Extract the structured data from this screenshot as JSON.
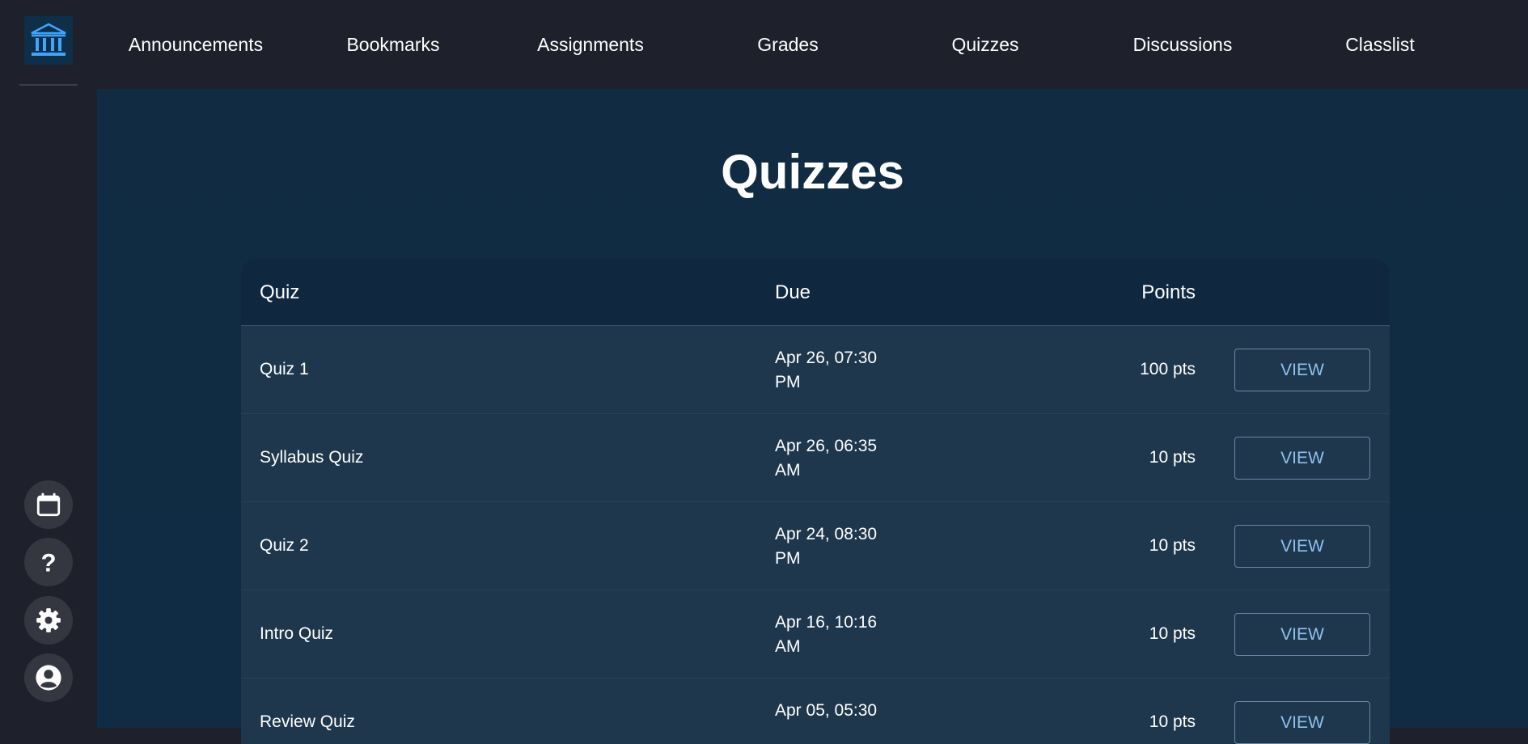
{
  "nav": {
    "items": [
      {
        "label": "Announcements"
      },
      {
        "label": "Bookmarks"
      },
      {
        "label": "Assignments"
      },
      {
        "label": "Grades"
      },
      {
        "label": "Quizzes"
      },
      {
        "label": "Discussions"
      },
      {
        "label": "Classlist"
      }
    ]
  },
  "sidebar": {
    "logo_icon": "institution-icon",
    "buttons": [
      {
        "icon": "calendar-icon"
      },
      {
        "icon": "help-icon"
      },
      {
        "icon": "settings-icon"
      },
      {
        "icon": "account-icon"
      }
    ]
  },
  "page": {
    "title": "Quizzes"
  },
  "table": {
    "headers": {
      "quiz": "Quiz",
      "due": "Due",
      "points": "Points"
    },
    "rows": [
      {
        "name": "Quiz 1",
        "due_line1": "Apr 26, 07:30",
        "due_line2": "PM",
        "points": "100 pts",
        "action": "VIEW"
      },
      {
        "name": "Syllabus Quiz",
        "due_line1": "Apr 26, 06:35",
        "due_line2": "AM",
        "points": "10 pts",
        "action": "VIEW"
      },
      {
        "name": "Quiz 2",
        "due_line1": "Apr 24, 08:30",
        "due_line2": "PM",
        "points": "10 pts",
        "action": "VIEW"
      },
      {
        "name": "Intro Quiz",
        "due_line1": "Apr 16, 10:16",
        "due_line2": "AM",
        "points": "10 pts",
        "action": "VIEW"
      },
      {
        "name": "Review Quiz",
        "due_line1": "Apr 05, 05:30",
        "due_line2": "",
        "points": "10 pts",
        "action": "VIEW"
      }
    ]
  },
  "colors": {
    "background": "#1e212b",
    "main_bg": "#112c42",
    "table_row": "#1f374d",
    "table_header": "#0f2840",
    "accent": "#8ec0ef",
    "logo": "#3ea6ff"
  }
}
